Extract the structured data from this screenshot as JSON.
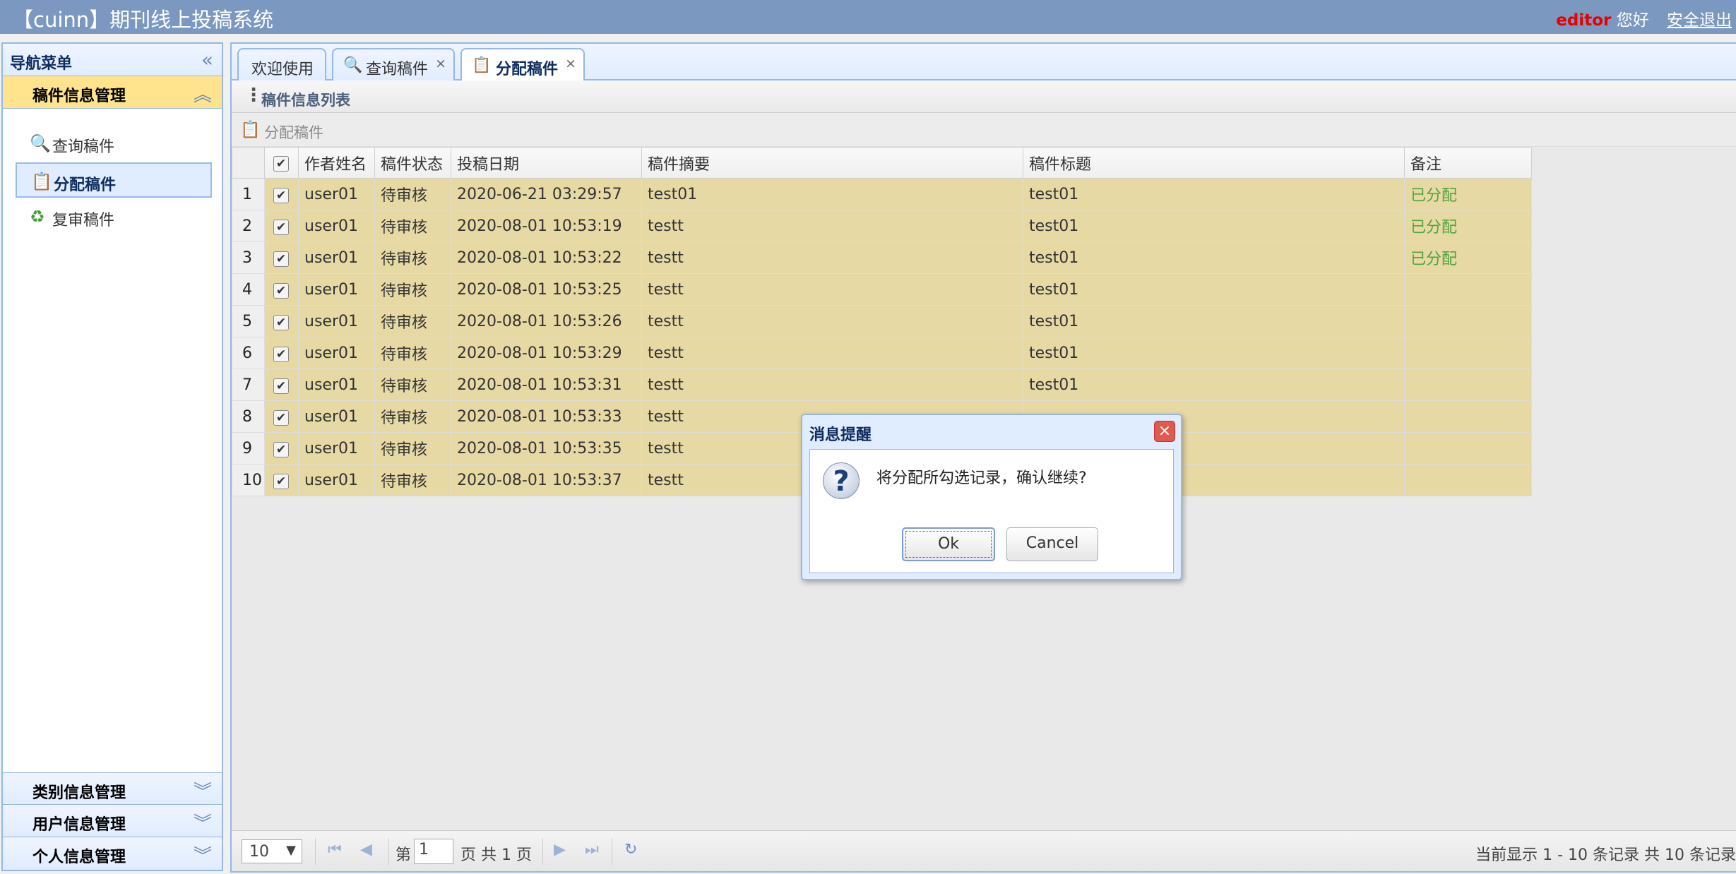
{
  "header": {
    "title": "【cuinn】期刊线上投稿系统",
    "username": "editor",
    "greeting": "您好",
    "logout": "安全退出"
  },
  "nav": {
    "title": "导航菜单",
    "collapse_icon": "«",
    "sections": [
      {
        "label": "稿件信息管理",
        "arrow": "︽"
      },
      {
        "label": "类别信息管理",
        "arrow": "︾"
      },
      {
        "label": "用户信息管理",
        "arrow": "︾"
      },
      {
        "label": "个人信息管理",
        "arrow": "︾"
      }
    ],
    "items": [
      {
        "label": "查询稿件",
        "icon": "🔍"
      },
      {
        "label": "分配稿件",
        "icon": "📋"
      },
      {
        "label": "复审稿件",
        "icon": "♻"
      }
    ]
  },
  "tabs": [
    {
      "label": "欢迎使用"
    },
    {
      "label": "查询稿件",
      "icon": "🔍",
      "close": "×"
    },
    {
      "label": "分配稿件",
      "icon": "📋",
      "close": "×"
    }
  ],
  "grid": {
    "title": "稿件信息列表",
    "toolbar_button": "分配稿件",
    "columns": [
      "作者姓名",
      "稿件状态",
      "投稿日期",
      "稿件摘要",
      "稿件标题",
      "备注"
    ],
    "check_mark": "✔",
    "rows": [
      {
        "n": "1",
        "author": "user01",
        "status": "待审核",
        "date": "2020-06-21 03:29:57",
        "summary": "test01",
        "title": "test01",
        "note": "已分配"
      },
      {
        "n": "2",
        "author": "user01",
        "status": "待审核",
        "date": "2020-08-01 10:53:19",
        "summary": "testt",
        "title": "test01",
        "note": "已分配"
      },
      {
        "n": "3",
        "author": "user01",
        "status": "待审核",
        "date": "2020-08-01 10:53:22",
        "summary": "testt",
        "title": "test01",
        "note": "已分配"
      },
      {
        "n": "4",
        "author": "user01",
        "status": "待审核",
        "date": "2020-08-01 10:53:25",
        "summary": "testt",
        "title": "test01",
        "note": ""
      },
      {
        "n": "5",
        "author": "user01",
        "status": "待审核",
        "date": "2020-08-01 10:53:26",
        "summary": "testt",
        "title": "test01",
        "note": ""
      },
      {
        "n": "6",
        "author": "user01",
        "status": "待审核",
        "date": "2020-08-01 10:53:29",
        "summary": "testt",
        "title": "test01",
        "note": ""
      },
      {
        "n": "7",
        "author": "user01",
        "status": "待审核",
        "date": "2020-08-01 10:53:31",
        "summary": "testt",
        "title": "test01",
        "note": ""
      },
      {
        "n": "8",
        "author": "user01",
        "status": "待审核",
        "date": "2020-08-01 10:53:33",
        "summary": "testt",
        "title": "",
        "note": ""
      },
      {
        "n": "9",
        "author": "user01",
        "status": "待审核",
        "date": "2020-08-01 10:53:35",
        "summary": "testt",
        "title": "",
        "note": ""
      },
      {
        "n": "10",
        "author": "user01",
        "status": "待审核",
        "date": "2020-08-01 10:53:37",
        "summary": "testt",
        "title": "",
        "note": ""
      }
    ]
  },
  "pager": {
    "page_size": "10",
    "page_prefix": "第",
    "page_value": "1",
    "page_suffix": "页 共 1 页",
    "info": "当前显示 1 - 10 条记录 共 10 条记录"
  },
  "dialog": {
    "title": "消息提醒",
    "message": "将分配所勾选记录，确认继续?",
    "ok": "Ok",
    "cancel": "Cancel",
    "close": "×",
    "icon": "?"
  },
  "colors": {
    "header_bg": "#7b98c0",
    "row_selected_bg": "#e7d9a4",
    "active_section_bg": "#ffe48d",
    "note_text": "#52a23e"
  }
}
